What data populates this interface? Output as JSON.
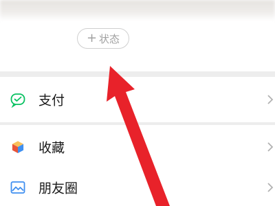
{
  "header": {
    "status_button": {
      "plus": "+",
      "label": "状态"
    }
  },
  "menu": {
    "items": [
      {
        "label": "支付",
        "icon": "wechat-pay-icon"
      },
      {
        "label": "收藏",
        "icon": "favorites-cube-icon"
      },
      {
        "label": "朋友圈",
        "icon": "moments-image-icon"
      }
    ]
  },
  "colors": {
    "pay_green": "#07c160",
    "arrow_red": "#e8222a",
    "background": "#ededed"
  }
}
